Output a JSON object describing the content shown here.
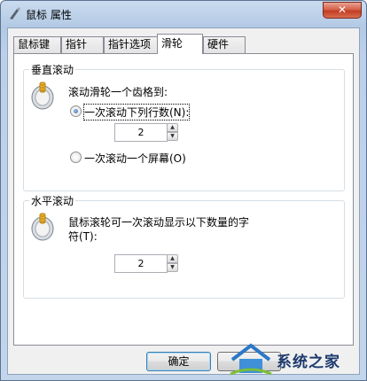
{
  "window": {
    "title": "鼠标 属性",
    "close_glyph": "✕"
  },
  "tabs": [
    {
      "label": "鼠标键",
      "active": false
    },
    {
      "label": "指针",
      "active": false
    },
    {
      "label": "指针选项",
      "active": false
    },
    {
      "label": "滑轮",
      "active": true
    },
    {
      "label": "硬件",
      "active": false
    }
  ],
  "vertical": {
    "title": "垂直滚动",
    "prompt": "滚动滑轮一个齿格到:",
    "option_lines_label": "一次滚动下列行数(N):",
    "option_lines_checked": true,
    "lines_value": "2",
    "option_screen_label": "一次滚动一个屏幕(O)",
    "option_screen_checked": false
  },
  "horizontal": {
    "title": "水平滚动",
    "prompt_line1": "鼠标滚轮可一次滚动显示以下数量的字",
    "prompt_line2": "符(T):",
    "chars_value": "2"
  },
  "buttons": {
    "ok": "确定"
  },
  "watermark": {
    "text": "系统之家"
  },
  "icons": [
    "app-icon",
    "close-icon",
    "mouse-wheel-icon",
    "spin-up-icon",
    "spin-down-icon"
  ]
}
